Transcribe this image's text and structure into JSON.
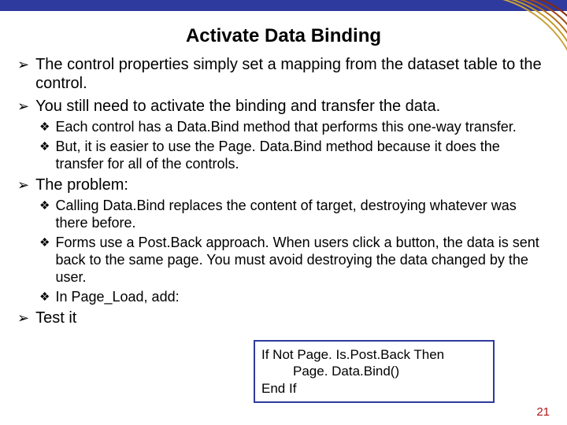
{
  "title": "Activate Data Binding",
  "bullets": {
    "b1": "The control properties simply set a mapping from the dataset table to the control.",
    "b2": "You still need to activate the binding and transfer the data.",
    "b2a": "Each control has a Data.Bind method that performs this one-way transfer.",
    "b2b": "But, it is easier to use the Page. Data.Bind method because it does the transfer for all of the controls.",
    "b3": "The problem:",
    "b3a": "Calling Data.Bind replaces the content of target, destroying whatever was there before.",
    "b3b": "Forms use a Post.Back approach. When users click a button, the data is sent back to the same page. You must avoid destroying the data changed by the user.",
    "b3c": "In Page_Load, add:",
    "b4": "Test it"
  },
  "code": {
    "l1": "If Not Page. Is.Post.Back Then",
    "l2": "Page. Data.Bind()",
    "l3": "End If"
  },
  "slide_number": "21"
}
